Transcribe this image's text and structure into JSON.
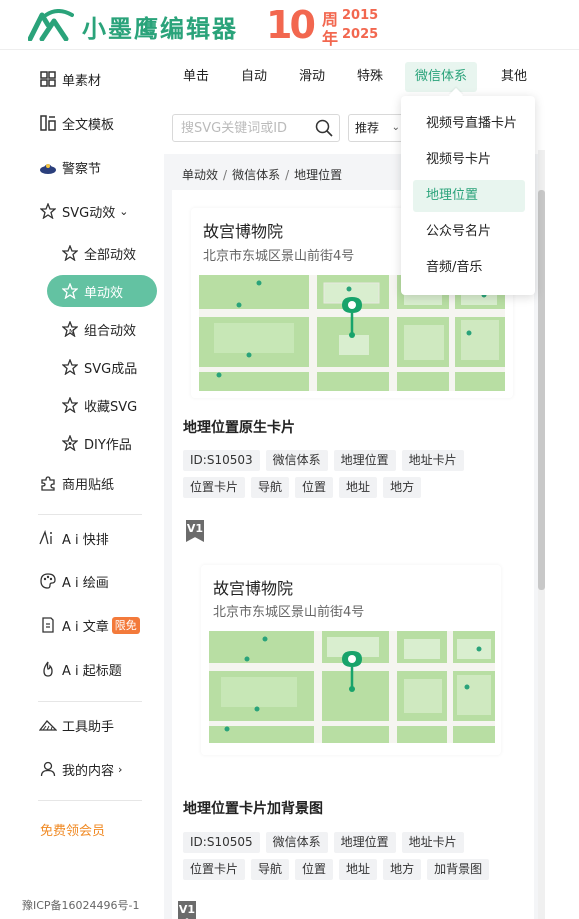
{
  "brand": {
    "name": "小墨鹰编辑器",
    "anniversary_number": "10",
    "anniversary_zhou": "周",
    "anniversary_nian": "年",
    "year_start": "2015",
    "year_end": "2025",
    "brand_color": "#2aa37a",
    "anniversary_color": "#f2674f"
  },
  "sidebar": {
    "items": [
      {
        "label": "单素材",
        "icon": "grid-icon"
      },
      {
        "label": "全文模板",
        "icon": "template-icon"
      },
      {
        "label": "警察节",
        "icon": "police-icon"
      },
      {
        "label": "SVG动效",
        "icon": "star-icon"
      },
      {
        "label": "全部动效",
        "icon": "star-outline-icon"
      },
      {
        "label": "单动效",
        "icon": "star-outline-icon"
      },
      {
        "label": "组合动效",
        "icon": "star-n-icon"
      },
      {
        "label": "SVG成品",
        "icon": "star-outline-icon"
      },
      {
        "label": "收藏SVG",
        "icon": "star-outline-icon"
      },
      {
        "label": "DIY作品",
        "icon": "star-diy-icon"
      },
      {
        "label": "商用贴纸",
        "icon": "puzzle-icon"
      },
      {
        "label": "A i 快排",
        "icon": "ai-icon"
      },
      {
        "label": "A i 绘画",
        "icon": "palette-icon"
      },
      {
        "label": "A i 文章",
        "icon": "document-icon"
      },
      {
        "label": "A i 起标题",
        "icon": "flame-icon"
      },
      {
        "label": "工具助手",
        "icon": "tools-icon"
      },
      {
        "label": "我的内容",
        "icon": "user-icon"
      }
    ],
    "limit_badge": "限免",
    "free_vip": "免费领会员",
    "icp": "豫ICP备16024496号-1",
    "active_color": "#63c2a2"
  },
  "tabs": [
    "单击",
    "自动",
    "滑动",
    "特殊",
    "微信体系",
    "其他"
  ],
  "search": {
    "placeholder": "搜SVG关键词或ID"
  },
  "sort": {
    "value": "推荐"
  },
  "breadcrumb": [
    "单动效",
    "微信体系",
    "地理位置"
  ],
  "dropdown": [
    "视频号直播卡片",
    "视频号卡片",
    "地理位置",
    "公众号名片",
    "音频/音乐"
  ],
  "cards": [
    {
      "poi_name": "故宫博物院",
      "poi_address": "北京市东城区景山前街4号",
      "title": "地理位置原生卡片",
      "tags": [
        "ID:S10503",
        "微信体系",
        "地理位置",
        "地址卡片",
        "位置卡片",
        "导航",
        "位置",
        "地址",
        "地方"
      ]
    },
    {
      "badge": "V1",
      "poi_name": "故宫博物院",
      "poi_address": "北京市东城区景山前街4号",
      "title": "地理位置卡片加背景图",
      "tags": [
        "ID:S10505",
        "微信体系",
        "地理位置",
        "地址卡片",
        "位置卡片",
        "导航",
        "位置",
        "地址",
        "地方",
        "加背景图"
      ]
    }
  ],
  "next_badge": "V1"
}
